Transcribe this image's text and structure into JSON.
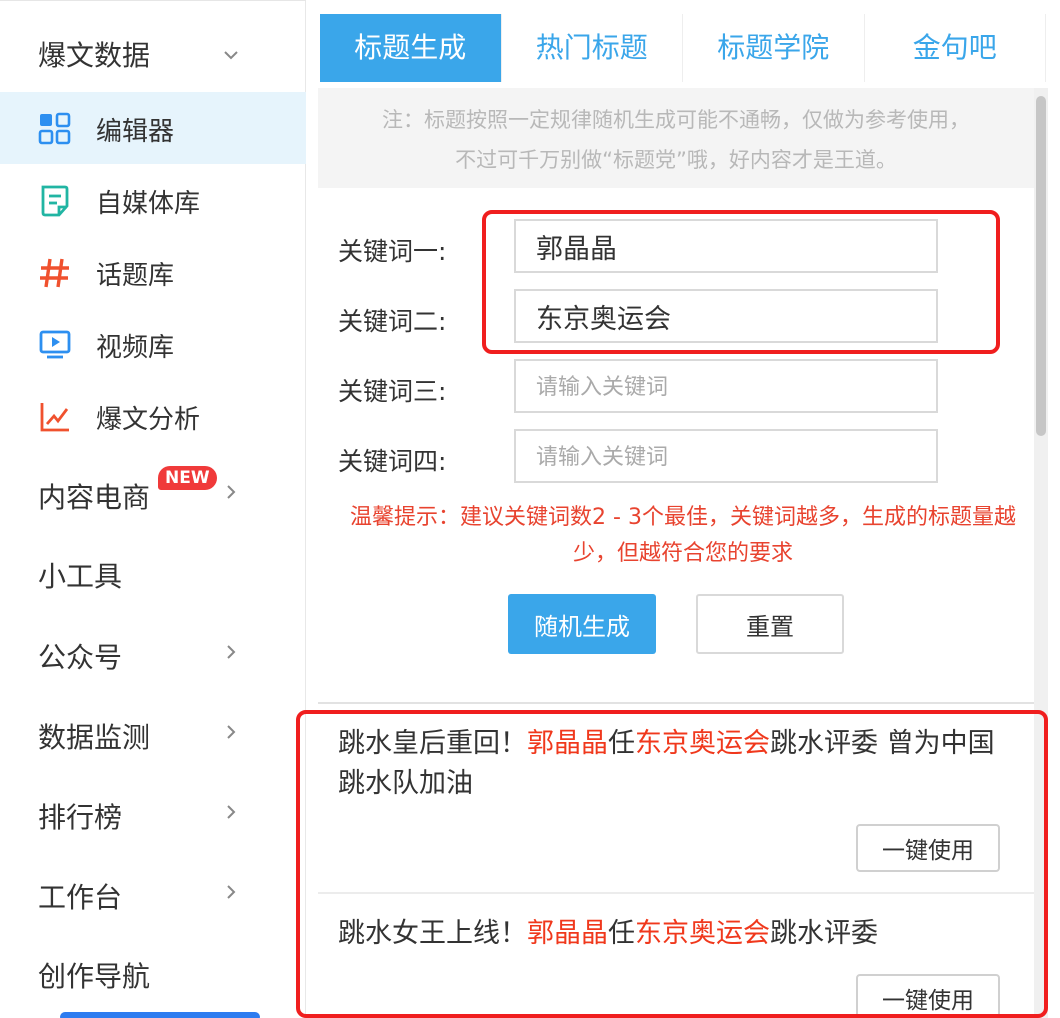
{
  "sidebar": {
    "groups": {
      "viral_data": "爆文数据",
      "content_ecommerce": "内容电商",
      "new_badge": "NEW",
      "tools": "小工具",
      "official_account": "公众号",
      "data_monitor": "数据监测",
      "rankings": "排行榜",
      "workbench": "工作台",
      "creation_nav": "创作导航"
    },
    "items": [
      {
        "label": "编辑器",
        "icon": "grid-icon"
      },
      {
        "label": "自媒体库",
        "icon": "document-icon"
      },
      {
        "label": "话题库",
        "icon": "hashtag-icon"
      },
      {
        "label": "视频库",
        "icon": "video-icon"
      },
      {
        "label": "爆文分析",
        "icon": "chart-icon"
      }
    ]
  },
  "tabs": [
    "标题生成",
    "热门标题",
    "标题学院",
    "金句吧"
  ],
  "notice": {
    "line1": "注：标题按照一定规律随机生成可能不通畅，仅做为参考使用，",
    "line2": "不过可千万别做“标题党”哦，好内容才是王道。"
  },
  "form": {
    "keywords": [
      {
        "label": "关键词一:",
        "value": "郭晶晶",
        "placeholder": ""
      },
      {
        "label": "关键词二:",
        "value": "东京奥运会",
        "placeholder": ""
      },
      {
        "label": "关键词三:",
        "value": "",
        "placeholder": "请输入关键词"
      },
      {
        "label": "关键词四:",
        "value": "",
        "placeholder": "请输入关键词"
      }
    ],
    "tip": "温馨提示：建议关键词数2 - 3个最佳，关键词越多，生成的标题量越少，但越符合您的要求",
    "generate_label": "随机生成",
    "reset_label": "重置"
  },
  "results": [
    {
      "parts": [
        "跳水皇后重回！",
        "郭晶晶",
        "任",
        "东京奥运会",
        "跳水评委 曾为中国跳水队加油"
      ],
      "use_label": "一键使用"
    },
    {
      "parts": [
        "跳水女王上线！",
        "郭晶晶",
        "任",
        "东京奥运会",
        "跳水评委"
      ],
      "use_label": "一键使用"
    }
  ],
  "colors": {
    "accent": "#3aa6ea",
    "highlight": "#f0381c",
    "tip": "#e8432f",
    "annotation": "#f01e1e"
  }
}
